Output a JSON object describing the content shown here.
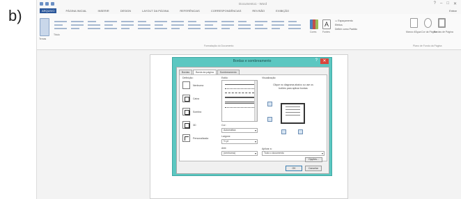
{
  "figure_label": "b)",
  "app": {
    "title": "Documento1 - Word",
    "tabs": [
      "ARQUIVO",
      "PÁGINA INICIAL",
      "INSERIR",
      "DESIGN",
      "LAYOUT DA PÁGINA",
      "REFERÊNCIAS",
      "CORRESPONDÊNCIAS",
      "REVISÃO",
      "EXIBIÇÃO"
    ],
    "signin": "Entrar"
  },
  "ribbon": {
    "items": [
      "Temas",
      "Título",
      "Cores",
      "Fontes",
      "Efeitos",
      "Definir como Padrão",
      "Marca d'Água",
      "Cor da Página",
      "Bordas de Página"
    ],
    "groups": [
      "Formatação do Documento",
      "Plano de Fundo da Página"
    ]
  },
  "dialog": {
    "title": "Bordas e sombreamento",
    "help": "?",
    "close": "✕",
    "tabs": [
      "Bordas",
      "Borda da página",
      "Sombreamento"
    ],
    "active_tab": 1,
    "setting_label": "Definição:",
    "settings": [
      "Nenhuma",
      "Caixa",
      "Sombra",
      "3D",
      "Personalizada"
    ],
    "style_label": "Estilo:",
    "color_label": "Cor:",
    "color_value": "Automática",
    "width_label": "Largura:",
    "width_value": "½ pt",
    "art_label": "Arte:",
    "art_value": "(nenhuma)",
    "preview_label": "Visualização",
    "preview_text": "Clique no diagrama abaixo ou use os botões para aplicar bordas",
    "apply_label": "Aplicar a:",
    "apply_value": "Todo o documento",
    "options_button": "Opções...",
    "ok_button": "OK",
    "cancel_button": "Cancelar"
  }
}
